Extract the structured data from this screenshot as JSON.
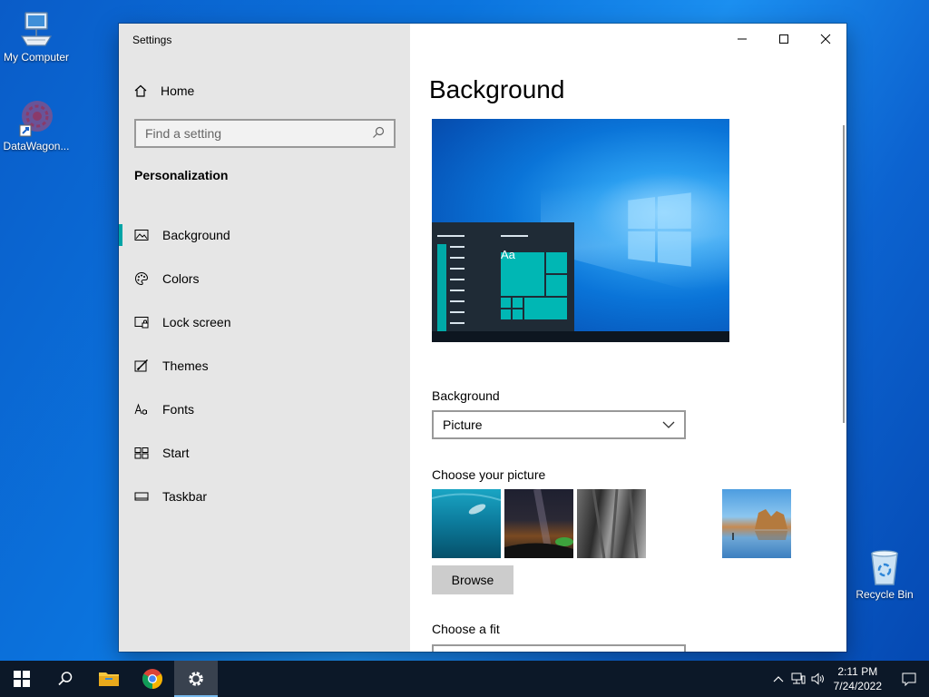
{
  "desktop": {
    "icons": {
      "my_computer": "My Computer",
      "datawagon": "DataWagon...",
      "recycle_bin": "Recycle Bin"
    }
  },
  "window": {
    "title": "Settings",
    "sidebar": {
      "home": "Home",
      "search_placeholder": "Find a setting",
      "section": "Personalization",
      "items": [
        {
          "label": "Background",
          "icon": "picture-icon",
          "active": true
        },
        {
          "label": "Colors",
          "icon": "palette-icon",
          "active": false
        },
        {
          "label": "Lock screen",
          "icon": "lock-screen-icon",
          "active": false
        },
        {
          "label": "Themes",
          "icon": "themes-icon",
          "active": false
        },
        {
          "label": "Fonts",
          "icon": "fonts-icon",
          "active": false
        },
        {
          "label": "Start",
          "icon": "start-icon",
          "active": false
        },
        {
          "label": "Taskbar",
          "icon": "taskbar-icon",
          "active": false
        }
      ]
    },
    "content": {
      "title": "Background",
      "preview_tile_text": "Aa",
      "background_label": "Background",
      "background_value": "Picture",
      "choose_picture_label": "Choose your picture",
      "browse_label": "Browse",
      "choose_fit_label": "Choose a fit"
    }
  },
  "taskbar": {
    "time": "2:11 PM",
    "date": "7/24/2022"
  },
  "colors": {
    "accent": "#00a4a6",
    "taskbar": "#0c1828",
    "sidebar": "#e6e6e6"
  }
}
